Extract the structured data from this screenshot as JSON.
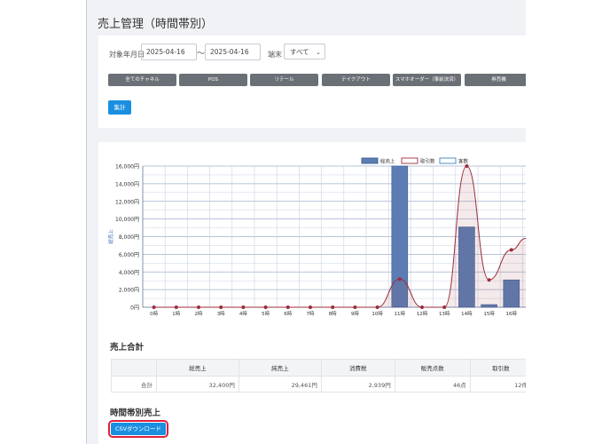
{
  "page": {
    "title": "売上管理（時間帯別）"
  },
  "filters": {
    "period_label": "対象年月日",
    "date_from": "2025-04-16",
    "tilde": "〜",
    "date_to": "2025-04-16",
    "terminal_label": "端末",
    "terminal_value": "すべて"
  },
  "channels": [
    "全てのチャネル",
    "POS",
    "リテール",
    "テイクアウト",
    "スマホオーダー（事前決済）",
    "券売機"
  ],
  "aggregate_label": "集計",
  "chart_data": {
    "type": "bar",
    "categories": [
      "0時",
      "1時",
      "2時",
      "3時",
      "4時",
      "5時",
      "6時",
      "7時",
      "8時",
      "9時",
      "10時",
      "11時",
      "12時",
      "13時",
      "14時",
      "15時",
      "16時"
    ],
    "ylabel": "総売上",
    "ylim": [
      0,
      16000
    ],
    "yticks": [
      "0円",
      "2,000円",
      "4,000円",
      "6,000円",
      "8,000円",
      "10,000円",
      "12,000円",
      "14,000円",
      "16,000円"
    ],
    "grid": true,
    "legend_position": "top",
    "legend": [
      "総売上",
      "取引数",
      "客数"
    ],
    "series": [
      {
        "name": "総売上",
        "kind": "bar",
        "color": "#5b7db4",
        "values": [
          0,
          0,
          0,
          0,
          0,
          0,
          0,
          0,
          0,
          0,
          0,
          16000,
          0,
          0,
          9100,
          300,
          3100
        ]
      },
      {
        "name": "取引数",
        "kind": "line",
        "color": "#9b2d3b",
        "values": [
          0,
          0,
          0,
          0,
          0,
          0,
          0,
          0,
          0,
          0,
          0,
          3200,
          0,
          0,
          16000,
          3100,
          6500
        ]
      },
      {
        "name": "客数",
        "kind": "line",
        "color": "#3b86c6",
        "values": []
      }
    ],
    "y2_visible_at_edge": 7800
  },
  "summary": {
    "title": "売上合計",
    "headers": [
      "",
      "総売上",
      "純売上",
      "消費税",
      "販売点数",
      "取引数"
    ],
    "row": [
      "合計",
      "32,400円",
      "29,461円",
      "2,939円",
      "46点",
      "12件"
    ]
  },
  "hourly": {
    "title": "時間帯別売上",
    "csv_label": "CSVダウンロード"
  }
}
